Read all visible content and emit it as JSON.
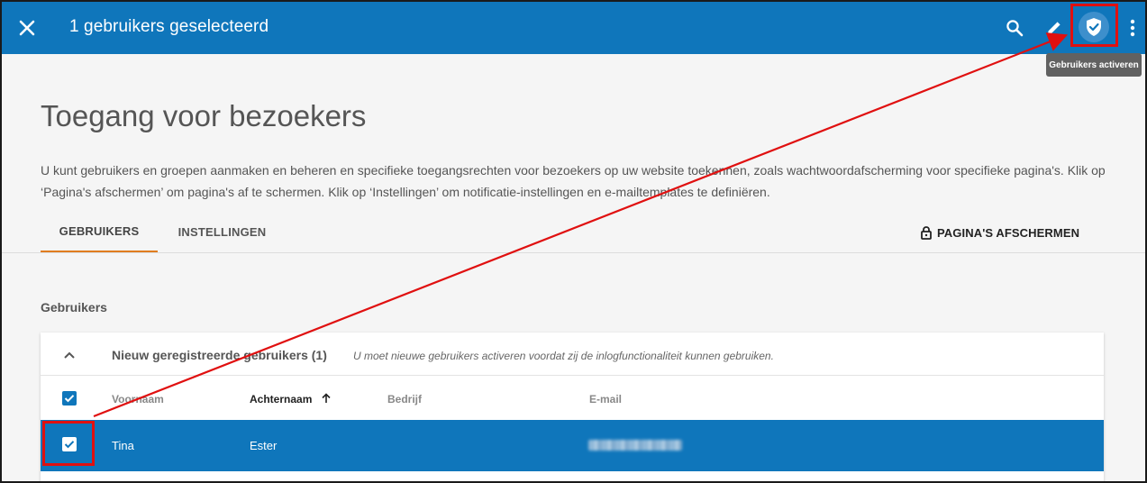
{
  "appbar": {
    "title": "1 gebruikers geselecteerd",
    "icons": {
      "close": "close-icon",
      "search": "search-icon",
      "edit": "pencil-icon",
      "activate": "shield-check-icon",
      "more": "more-vert-icon"
    },
    "tooltip": "Gebruikers activeren",
    "background": "#0f76bb"
  },
  "page": {
    "title": "Toegang voor bezoekers",
    "description": "U kunt gebruikers en groepen aanmaken en beheren en specifieke toegangsrechten voor bezoekers op uw website toekennen, zoals wachtwoordafscherming voor specifieke pagina's. Klik op ‘Pagina's afschermen’ om pagina's af te schermen. Klik op ‘Instellingen’ om notificatie-instellingen en e-mailtemplates te definiëren."
  },
  "tabs": [
    {
      "label": "GEBRUIKERS",
      "active": true
    },
    {
      "label": "INSTELLINGEN",
      "active": false
    }
  ],
  "protect_button": {
    "label": "PAGINA'S AFSCHERMEN",
    "icon": "lock-icon"
  },
  "section": {
    "label": "Gebruikers"
  },
  "group": {
    "title": "Nieuw geregistreerde gebruikers (1)",
    "note": "U moet nieuwe gebruikers activeren voordat zij de inlogfunctionaliteit kunnen gebruiken.",
    "expanded": true
  },
  "table": {
    "columns": [
      "Voornaam",
      "Achternaam",
      "Bedrijf",
      "E-mail"
    ],
    "sorted_column": "Achternaam",
    "sort_direction": "ascending",
    "rows": [
      {
        "voornaam": "Tina",
        "achternaam": "Ester",
        "bedrijf": "",
        "email_blurred": true,
        "selected": true
      }
    ]
  },
  "colors": {
    "accent": "#0f76bb",
    "tab_indicator": "#e07d1f",
    "annotation": "#e01010"
  }
}
